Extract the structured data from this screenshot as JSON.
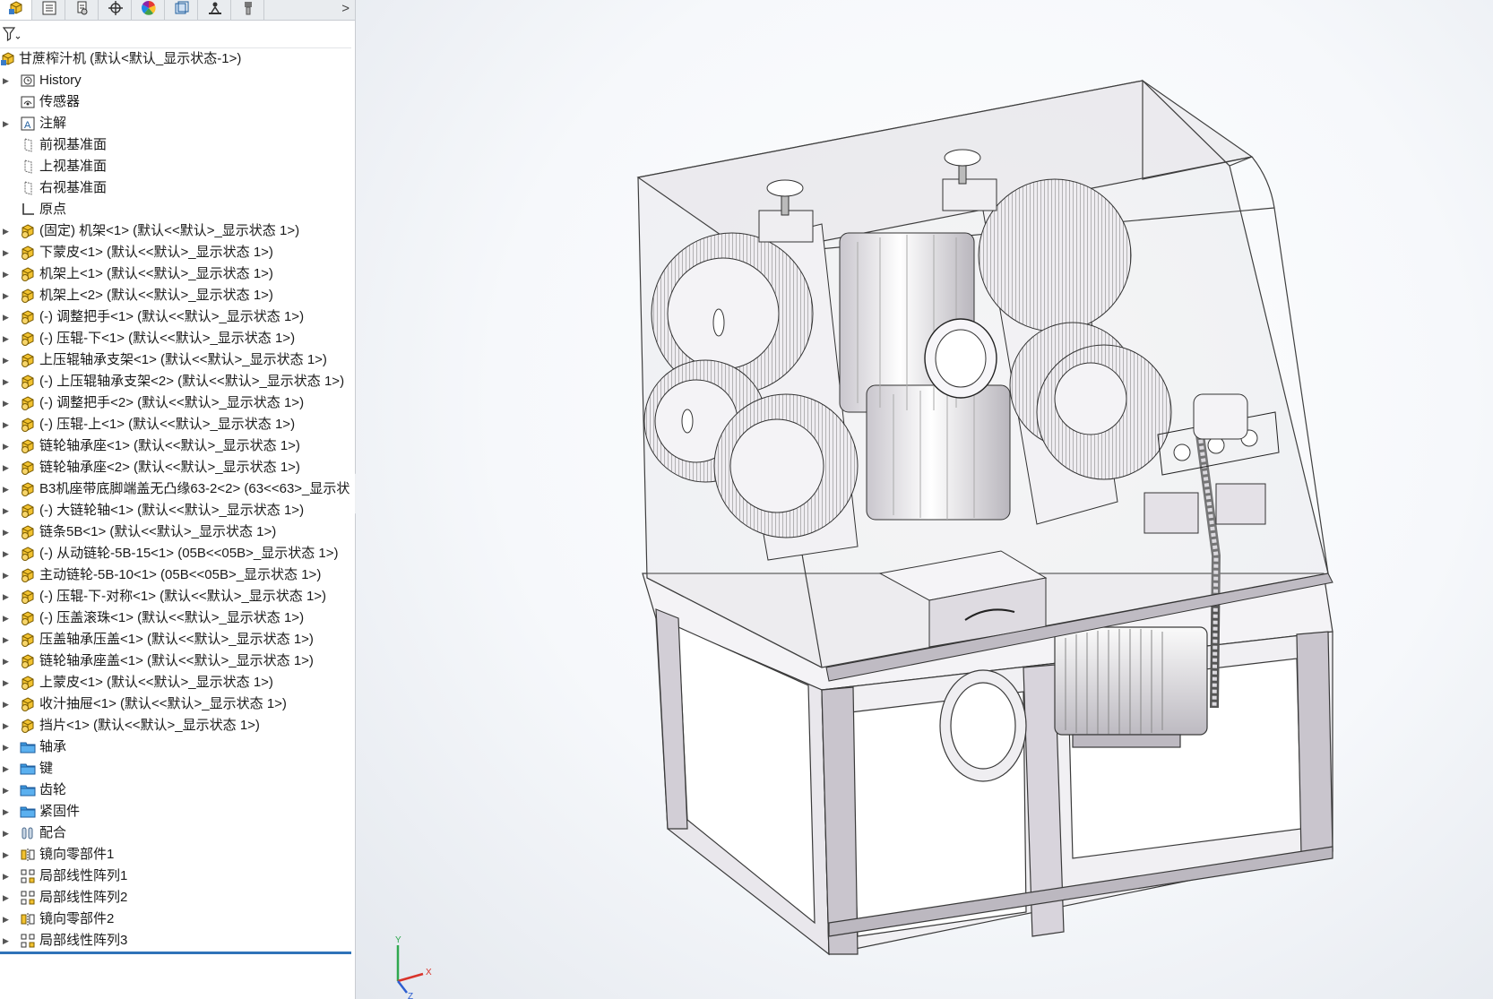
{
  "panel": {
    "tabs": [
      {
        "name": "feature-manager-tab",
        "icon": "assembly-tree-icon"
      },
      {
        "name": "property-manager-tab",
        "icon": "property-list-icon"
      },
      {
        "name": "configuration-manager-tab",
        "icon": "configuration-icon"
      },
      {
        "name": "dimxpert-tab",
        "icon": "crosshair-icon"
      },
      {
        "name": "display-manager-tab",
        "icon": "color-wheel-icon"
      },
      {
        "name": "cam-tab",
        "icon": "cube-box-icon"
      },
      {
        "name": "simulation-tab",
        "icon": "figure-icon"
      },
      {
        "name": "design-checker-tab",
        "icon": "brush-icon"
      }
    ],
    "more_arrow": ">",
    "filter": {
      "icon": "filter-icon",
      "placeholder": ""
    },
    "root": {
      "label": "甘蔗榨汁机  (默认<默认_显示状态-1>)",
      "icon": "assembly-icon"
    },
    "items": [
      {
        "label": "History",
        "icon": "history-icon",
        "expandable": true
      },
      {
        "label": "传感器",
        "icon": "sensor-icon",
        "expandable": false
      },
      {
        "label": "注解",
        "icon": "annotation-icon",
        "expandable": true
      },
      {
        "label": "前视基准面",
        "icon": "plane-icon",
        "expandable": false
      },
      {
        "label": "上视基准面",
        "icon": "plane-icon",
        "expandable": false
      },
      {
        "label": "右视基准面",
        "icon": "plane-icon",
        "expandable": false
      },
      {
        "label": "原点",
        "icon": "origin-icon",
        "expandable": false
      },
      {
        "label": "(固定) 机架<1> (默认<<默认>_显示状态 1>)",
        "icon": "part-icon",
        "expandable": true
      },
      {
        "label": "下蒙皮<1> (默认<<默认>_显示状态 1>)",
        "icon": "part-icon",
        "expandable": true
      },
      {
        "label": "机架上<1> (默认<<默认>_显示状态 1>)",
        "icon": "part-icon",
        "expandable": true
      },
      {
        "label": "机架上<2> (默认<<默认>_显示状态 1>)",
        "icon": "part-icon",
        "expandable": true
      },
      {
        "label": "(-) 调整把手<1> (默认<<默认>_显示状态 1>)",
        "icon": "part-icon",
        "expandable": true
      },
      {
        "label": "(-) 压辊-下<1> (默认<<默认>_显示状态 1>)",
        "icon": "part-icon",
        "expandable": true
      },
      {
        "label": "上压辊轴承支架<1> (默认<<默认>_显示状态 1>)",
        "icon": "part-icon",
        "expandable": true
      },
      {
        "label": "(-) 上压辊轴承支架<2> (默认<<默认>_显示状态 1>)",
        "icon": "part-icon",
        "expandable": true
      },
      {
        "label": "(-) 调整把手<2> (默认<<默认>_显示状态 1>)",
        "icon": "part-icon",
        "expandable": true
      },
      {
        "label": "(-) 压辊-上<1> (默认<<默认>_显示状态 1>)",
        "icon": "part-icon",
        "expandable": true
      },
      {
        "label": "链轮轴承座<1> (默认<<默认>_显示状态 1>)",
        "icon": "part-icon",
        "expandable": true
      },
      {
        "label": "链轮轴承座<2> (默认<<默认>_显示状态 1>)",
        "icon": "part-icon",
        "expandable": true
      },
      {
        "label": "B3机座带底脚端盖无凸缘63-2<2> (63<<63>_显示状",
        "icon": "part-icon",
        "expandable": true
      },
      {
        "label": "(-) 大链轮轴<1> (默认<<默认>_显示状态 1>)",
        "icon": "part-icon",
        "expandable": true
      },
      {
        "label": "链条5B<1> (默认<<默认>_显示状态 1>)",
        "icon": "part-icon",
        "expandable": true
      },
      {
        "label": "(-) 从动链轮-5B-15<1> (05B<<05B>_显示状态 1>)",
        "icon": "part-icon",
        "expandable": true
      },
      {
        "label": "主动链轮-5B-10<1> (05B<<05B>_显示状态 1>)",
        "icon": "part-icon",
        "expandable": true
      },
      {
        "label": "(-) 压辊-下-对称<1> (默认<<默认>_显示状态 1>)",
        "icon": "part-icon",
        "expandable": true
      },
      {
        "label": "(-) 压盖滚珠<1> (默认<<默认>_显示状态 1>)",
        "icon": "part-icon",
        "expandable": true
      },
      {
        "label": "压盖轴承压盖<1> (默认<<默认>_显示状态 1>)",
        "icon": "part-icon",
        "expandable": true
      },
      {
        "label": "链轮轴承座盖<1> (默认<<默认>_显示状态 1>)",
        "icon": "part-icon",
        "expandable": true
      },
      {
        "label": "上蒙皮<1> (默认<<默认>_显示状态 1>)",
        "icon": "part-icon",
        "expandable": true
      },
      {
        "label": "收汁抽屉<1> (默认<<默认>_显示状态 1>)",
        "icon": "part-icon",
        "expandable": true
      },
      {
        "label": "挡片<1> (默认<<默认>_显示状态 1>)",
        "icon": "part-icon",
        "expandable": true
      },
      {
        "label": "轴承",
        "icon": "folder-icon",
        "expandable": true
      },
      {
        "label": "键",
        "icon": "folder-icon",
        "expandable": true
      },
      {
        "label": "齿轮",
        "icon": "folder-icon",
        "expandable": true
      },
      {
        "label": "紧固件",
        "icon": "folder-icon",
        "expandable": true
      },
      {
        "label": "配合",
        "icon": "mates-icon",
        "expandable": true
      },
      {
        "label": "镜向零部件1",
        "icon": "mirror-icon",
        "expandable": true
      },
      {
        "label": "局部线性阵列1",
        "icon": "pattern-icon",
        "expandable": true
      },
      {
        "label": "局部线性阵列2",
        "icon": "pattern-icon",
        "expandable": true
      },
      {
        "label": "镜向零部件2",
        "icon": "mirror-icon",
        "expandable": true
      },
      {
        "label": "局部线性阵列3",
        "icon": "pattern-icon",
        "expandable": true
      }
    ]
  },
  "viewport": {
    "model": "sugarcane-juicer-assembly",
    "triad": {
      "x": "X",
      "y": "Y",
      "z": "Z"
    },
    "colors": {
      "part": "#e6e3e9",
      "edge": "#3a3a3a",
      "shade": "#a9a5ad",
      "axis_x": "#d9342b",
      "axis_y": "#2fa84f",
      "axis_z": "#2d5fd1",
      "accent": "#2f73b8"
    }
  }
}
